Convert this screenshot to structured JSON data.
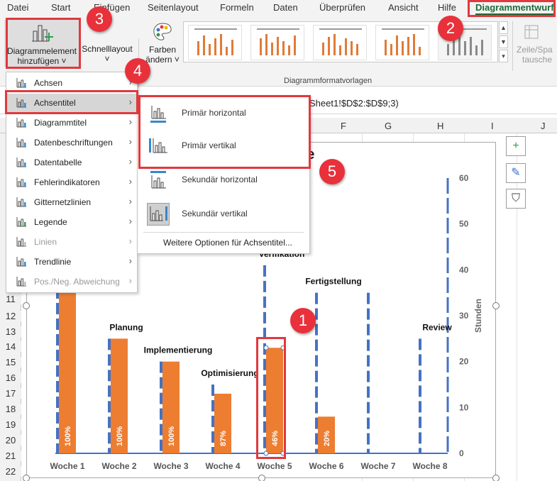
{
  "ribbon": {
    "tabs": [
      "Datei",
      "Start",
      "Einfügen",
      "Seitenlayout",
      "Formeln",
      "Daten",
      "Überprüfen",
      "Ansicht",
      "Hilfe",
      "Diagrammentwurf"
    ],
    "add_element_label_1": "Diagrammelement",
    "add_element_label_2": "hinzufügen ˅",
    "quick_layout_label": "Schnelllayout",
    "quick_layout_arrow": "˅",
    "colors_label_1": "Farben",
    "colors_label_2": "ändern ˅",
    "styles_group_label": "Diagrammformatvorlagen",
    "switch_label_1": "Zeile/Spa",
    "switch_label_2": "tausche"
  },
  "formula_fragment": "Sheet1!$D$2:$D$9;3)",
  "sheet": {
    "columns": [
      "F",
      "G",
      "H",
      "I",
      "J"
    ],
    "rows": [
      "11",
      "12",
      "13",
      "14",
      "15",
      "16",
      "17",
      "18",
      "19",
      "20",
      "21",
      "22"
    ]
  },
  "menu": {
    "items": [
      {
        "label": "Achsen",
        "disabled": false
      },
      {
        "label": "Achsentitel",
        "disabled": false
      },
      {
        "label": "Diagrammtitel",
        "disabled": false
      },
      {
        "label": "Datenbeschriftungen",
        "disabled": false
      },
      {
        "label": "Datentabelle",
        "disabled": false
      },
      {
        "label": "Fehlerindikatoren",
        "disabled": false
      },
      {
        "label": "Gitternetzlinien",
        "disabled": false
      },
      {
        "label": "Legende",
        "disabled": false
      },
      {
        "label": "Linien",
        "disabled": true
      },
      {
        "label": "Trendlinie",
        "disabled": false
      },
      {
        "label": "Pos./Neg. Abweichung",
        "disabled": true
      }
    ],
    "arrow": "›"
  },
  "submenu": {
    "items": [
      "Primär horizontal",
      "Primär vertikal",
      "Sekundär horizontal",
      "Sekundär vertikal"
    ],
    "more": "Weitere Optionen für Achsentitel..."
  },
  "side_buttons": {
    "add": "+",
    "style": "✎",
    "filter": "⛉"
  },
  "badges": [
    "1",
    "2",
    "3",
    "4",
    "5"
  ],
  "colors": {
    "bar": "#ed7d31",
    "error_bar": "#4472c4",
    "accent_red": "#e0393e",
    "tab_green": "#1e6b35"
  },
  "chart_data": {
    "type": "bar",
    "title": "ne",
    "categories": [
      "Woche 1",
      "Woche 2",
      "Woche 3",
      "Woche 4",
      "Woche 5",
      "Woche 6",
      "Woche 7",
      "Woche 8"
    ],
    "series": [
      {
        "values": [
          35,
          25,
          20,
          13,
          23,
          8,
          0,
          0
        ]
      }
    ],
    "data_labels": [
      "100%",
      "100%",
      "100%",
      "87%",
      "46%",
      "20%",
      "",
      ""
    ],
    "phase_labels": [
      "",
      "Planung",
      "Implementierung",
      "Optimisierung",
      "Verifikation",
      "Fertigstellung",
      "",
      "Review"
    ],
    "phase_heights": [
      60,
      25,
      20,
      15,
      41,
      35,
      35,
      25
    ],
    "secondary_ylabel": "Stunden",
    "secondary_ylim": [
      0,
      60
    ],
    "secondary_yticks": [
      0,
      10,
      20,
      30,
      40,
      50,
      60
    ],
    "legend": "none"
  }
}
